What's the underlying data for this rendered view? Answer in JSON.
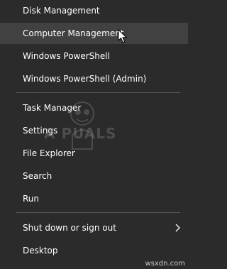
{
  "menu": {
    "items": [
      {
        "label": "Disk Management"
      },
      {
        "label": "Computer Management"
      },
      {
        "label": "Windows PowerShell"
      },
      {
        "label": "Windows PowerShell (Admin)"
      },
      {
        "label": "Task Manager"
      },
      {
        "label": "Settings"
      },
      {
        "label": "File Explorer"
      },
      {
        "label": "Search"
      },
      {
        "label": "Run"
      },
      {
        "label": "Shut down or sign out",
        "submenu_icon": "chevron-right-icon"
      },
      {
        "label": "Desktop"
      }
    ],
    "hovered_item": "Computer Management"
  },
  "watermark": {
    "text": "A PUALS"
  },
  "footer": {
    "text": "wsxdn.com"
  },
  "colors": {
    "background": "#2b2b2b",
    "hover": "#414141",
    "text": "#ffffff",
    "separator": "#555555"
  }
}
